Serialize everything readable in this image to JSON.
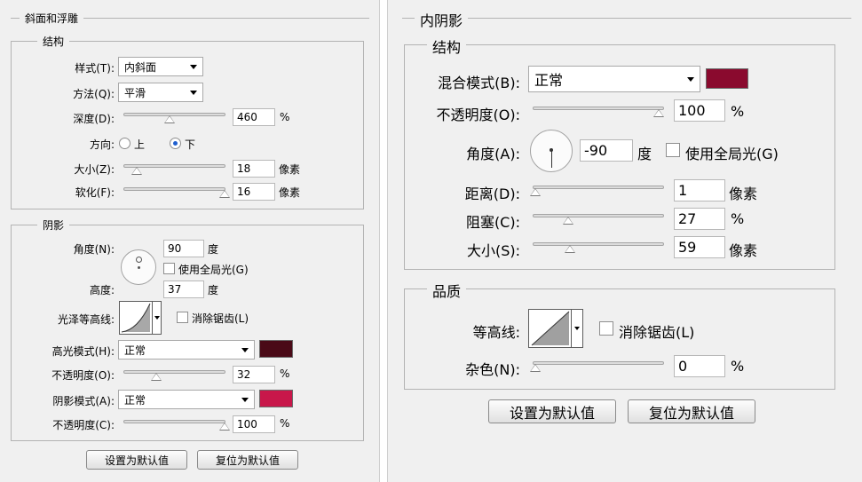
{
  "bevel": {
    "title": "斜面和浮雕",
    "structure": {
      "title": "结构",
      "style_label": "样式(T):",
      "style_value": "内斜面",
      "technique_label": "方法(Q):",
      "technique_value": "平滑",
      "depth_label": "深度(D):",
      "depth_value": "460",
      "depth_unit": "%",
      "direction_label": "方向:",
      "direction_up": "上",
      "direction_down": "下",
      "size_label": "大小(Z):",
      "size_value": "18",
      "size_unit": "像素",
      "soften_label": "软化(F):",
      "soften_value": "16",
      "soften_unit": "像素"
    },
    "shading": {
      "title": "阴影",
      "angle_label": "角度(N):",
      "angle_value": "90",
      "angle_unit": "度",
      "global_light_label": "使用全局光(G)",
      "altitude_label": "高度:",
      "altitude_value": "37",
      "altitude_unit": "度",
      "gloss_contour_label": "光泽等高线:",
      "anti_alias_label": "消除锯齿(L)",
      "highlight_mode_label": "高光模式(H):",
      "highlight_mode_value": "正常",
      "highlight_color": "#4a0a17",
      "highlight_opacity_label": "不透明度(O):",
      "highlight_opacity_value": "32",
      "highlight_opacity_unit": "%",
      "shadow_mode_label": "阴影模式(A):",
      "shadow_mode_value": "正常",
      "shadow_color": "#c8174a",
      "shadow_opacity_label": "不透明度(C):",
      "shadow_opacity_value": "100",
      "shadow_opacity_unit": "%"
    },
    "set_default": "设置为默认值",
    "reset_default": "复位为默认值"
  },
  "inner_shadow": {
    "title": "内阴影",
    "structure": {
      "title": "结构",
      "blend_mode_label": "混合模式(B):",
      "blend_mode_value": "正常",
      "color": "#8a0a2e",
      "opacity_label": "不透明度(O):",
      "opacity_value": "100",
      "opacity_unit": "%",
      "angle_label": "角度(A):",
      "angle_value": "-90",
      "angle_unit": "度",
      "global_light_label": "使用全局光(G)",
      "distance_label": "距离(D):",
      "distance_value": "1",
      "distance_unit": "像素",
      "choke_label": "阻塞(C):",
      "choke_value": "27",
      "choke_unit": "%",
      "size_label": "大小(S):",
      "size_value": "59",
      "size_unit": "像素"
    },
    "quality": {
      "title": "品质",
      "contour_label": "等高线:",
      "anti_alias_label": "消除锯齿(L)",
      "noise_label": "杂色(N):",
      "noise_value": "0",
      "noise_unit": "%"
    },
    "set_default": "设置为默认值",
    "reset_default": "复位为默认值"
  }
}
